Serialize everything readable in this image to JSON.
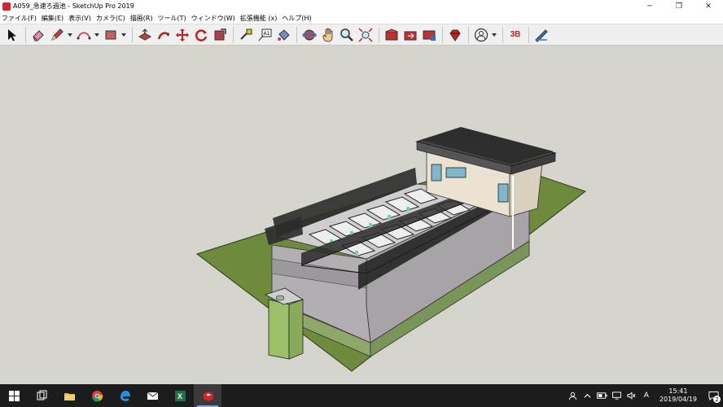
{
  "window": {
    "title": "A059_急速ろ過池 - SketchUp Pro 2019",
    "minimize": "─",
    "maximize": "❐",
    "close": "✕"
  },
  "menu": {
    "items": [
      {
        "label": "ファイル(F)",
        "name": "menu-file"
      },
      {
        "label": "編集(E)",
        "name": "menu-edit"
      },
      {
        "label": "表示(V)",
        "name": "menu-view"
      },
      {
        "label": "カメラ(C)",
        "name": "menu-camera"
      },
      {
        "label": "描画(R)",
        "name": "menu-draw"
      },
      {
        "label": "ツール(T)",
        "name": "menu-tools"
      },
      {
        "label": "ウィンドウ(W)",
        "name": "menu-window"
      },
      {
        "label": "拡張機能 (x)",
        "name": "menu-extensions"
      },
      {
        "label": "ヘルプ(H)",
        "name": "menu-help"
      }
    ]
  },
  "toolbar": {
    "tools": [
      {
        "icon": "select-arrow-icon",
        "dropdown": false
      },
      {
        "sep": true
      },
      {
        "icon": "eraser-icon",
        "dropdown": false
      },
      {
        "icon": "pencil-icon",
        "dropdown": true
      },
      {
        "icon": "arc-icon",
        "dropdown": true
      },
      {
        "icon": "rectangle-icon",
        "dropdown": true
      },
      {
        "sep": true
      },
      {
        "icon": "push-pull-icon",
        "dropdown": false
      },
      {
        "icon": "follow-me-icon",
        "dropdown": false
      },
      {
        "icon": "move-icon",
        "dropdown": false
      },
      {
        "icon": "rotate-icon",
        "dropdown": false
      },
      {
        "icon": "scale-icon",
        "dropdown": false
      },
      {
        "sep": true
      },
      {
        "icon": "tape-measure-icon",
        "dropdown": false
      },
      {
        "icon": "text-label-icon",
        "dropdown": false
      },
      {
        "icon": "paint-bucket-icon",
        "dropdown": false
      },
      {
        "sep": true
      },
      {
        "icon": "orbit-icon",
        "dropdown": false
      },
      {
        "icon": "pan-hand-icon",
        "dropdown": false
      },
      {
        "icon": "zoom-icon",
        "dropdown": false
      },
      {
        "icon": "zoom-extents-icon",
        "dropdown": false
      },
      {
        "sep": true
      },
      {
        "icon": "warehouse-icon",
        "dropdown": false
      },
      {
        "icon": "share-model-icon",
        "dropdown": false
      },
      {
        "icon": "extension-warehouse-icon",
        "dropdown": false
      },
      {
        "sep": true
      },
      {
        "icon": "ruby-icon",
        "dropdown": false
      },
      {
        "sep": true
      },
      {
        "icon": "account-icon",
        "dropdown": true
      },
      {
        "sep": true
      },
      {
        "icon": "3b-icon",
        "dropdown": false
      },
      {
        "sep": true
      },
      {
        "icon": "layout-icon",
        "dropdown": false
      }
    ],
    "text_tool_label": "A1",
    "logo_3b": "3B"
  },
  "colors": {
    "viewport_bg": "#d5d5ce",
    "ground": "#6e8a3c",
    "wall": "#a7a3a8",
    "accent": "#d8232a"
  },
  "taskbar": {
    "apps": [
      {
        "icon": "windows-start-icon",
        "active": false
      },
      {
        "icon": "task-view-icon",
        "active": false
      },
      {
        "icon": "file-explorer-icon",
        "active": false
      },
      {
        "icon": "chrome-icon",
        "active": false
      },
      {
        "icon": "edge-icon",
        "active": false
      },
      {
        "icon": "mail-icon",
        "active": false
      },
      {
        "icon": "excel-icon",
        "active": false
      },
      {
        "icon": "sketchup-icon",
        "active": true
      }
    ],
    "excel_letter": "X",
    "ime": "A",
    "time": "15:41",
    "date": "2019/04/19",
    "notifications": "2"
  }
}
